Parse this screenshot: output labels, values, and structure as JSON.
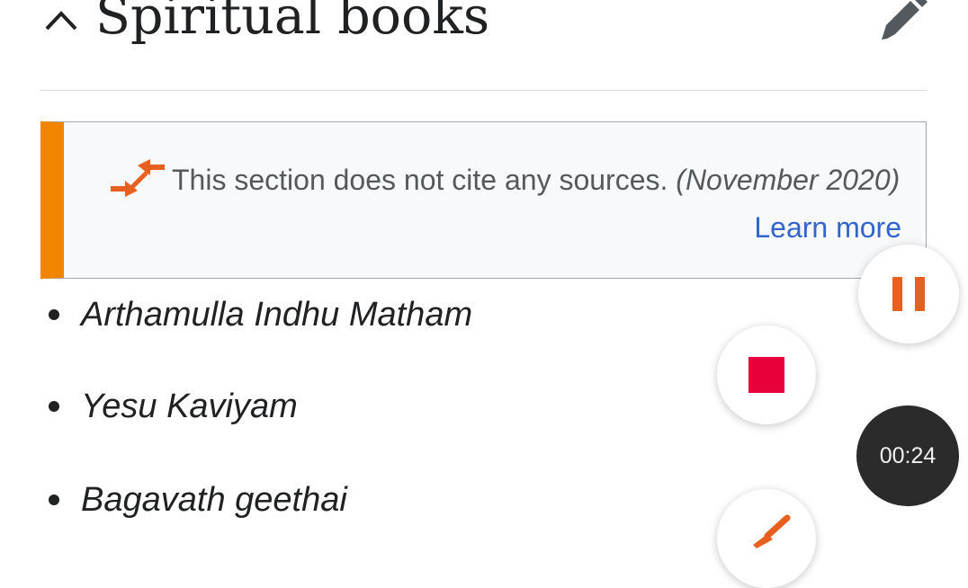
{
  "section": {
    "title": "Spiritual books",
    "collapse_icon": "chevron-up-icon",
    "edit_icon": "pencil-icon"
  },
  "notice": {
    "icon": "arrows-exchange-icon",
    "text": "This section does not cite any sources.",
    "date": "(November 2020)",
    "learn_more": "Learn more",
    "accent_color": "#f28500",
    "link_color": "#3366cc"
  },
  "books": [
    "Arthamulla Indhu Matham",
    "Yesu Kaviyam",
    "Bagavath geethai"
  ],
  "recorder": {
    "pause_icon": "pause-icon",
    "stop_icon": "stop-icon",
    "timer": "00:24",
    "brush_icon": "brush-icon",
    "pause_color": "#e8601f",
    "stop_color": "#e8003d"
  }
}
